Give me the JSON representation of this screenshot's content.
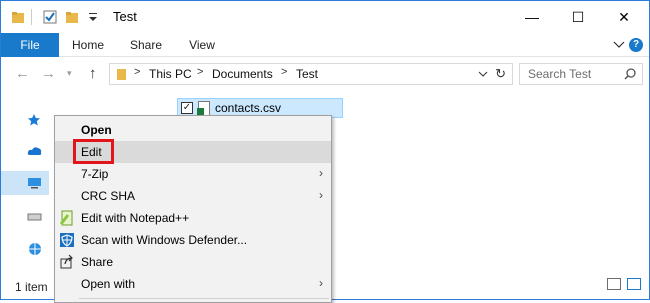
{
  "window": {
    "title": "Test",
    "controls": {
      "minimize": "—",
      "maximize": "☐",
      "close": "✕"
    }
  },
  "ribbon": {
    "tabs": [
      "File",
      "Home",
      "Share",
      "View"
    ],
    "help": "?"
  },
  "address": {
    "crumbs": [
      "This PC",
      "Documents",
      "Test"
    ],
    "separator": ">",
    "search_placeholder": "Search Test"
  },
  "file": {
    "name": "contacts.csv",
    "checkbox": "✓"
  },
  "status": {
    "text": "1 item"
  },
  "context_menu": {
    "items": [
      {
        "label": "Open",
        "bold": true
      },
      {
        "label": "Edit",
        "highlighted": true
      },
      {
        "label": "7-Zip",
        "submenu": true
      },
      {
        "label": "CRC SHA",
        "submenu": true
      },
      {
        "label": "Edit with Notepad++",
        "icon": "notepad-plus-plus-icon"
      },
      {
        "label": "Scan with Windows Defender...",
        "icon": "windows-defender-icon"
      },
      {
        "label": "Share",
        "icon": "share-icon"
      },
      {
        "label": "Open with",
        "submenu": true
      }
    ],
    "submenu_arrow": "›"
  },
  "colors": {
    "file_tab": "#1979ca",
    "selection": "#cce8ff",
    "highlight_box": "#e0161b",
    "menu_bg": "#f2f2f2"
  }
}
